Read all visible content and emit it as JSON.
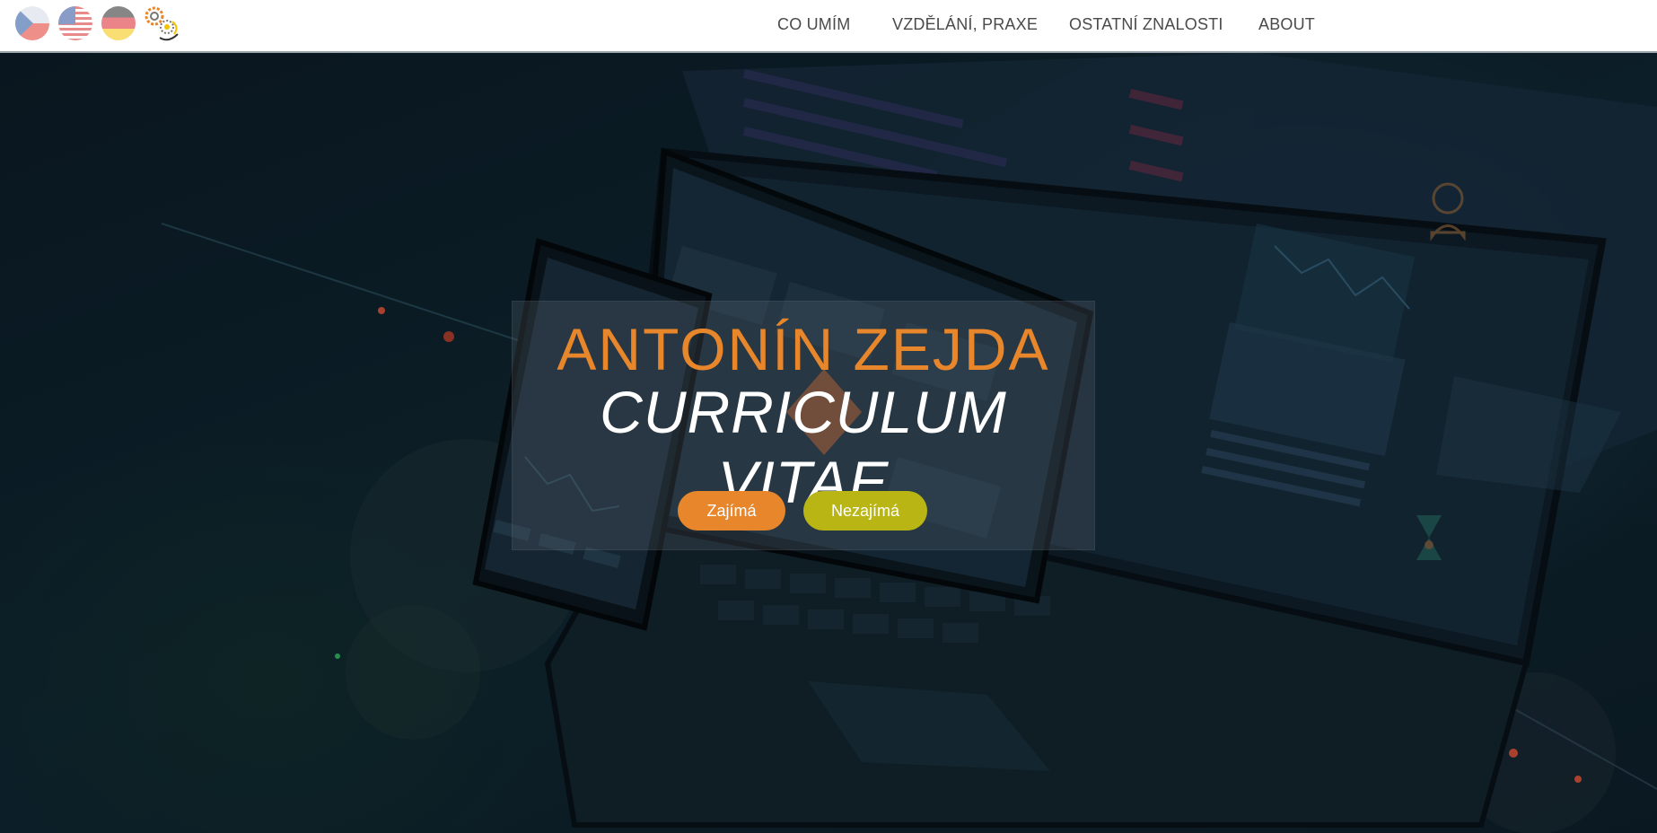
{
  "nav": {
    "languages": [
      {
        "name": "cz-flag-icon"
      },
      {
        "name": "us-flag-icon"
      },
      {
        "name": "de-flag-icon"
      }
    ],
    "logo_icon": "gear-logo-icon",
    "items": [
      "CO UMÍM",
      "VZDĚLÁNÍ, PRAXE",
      "OSTATNÍ ZNALOSTI",
      "ABOUT"
    ]
  },
  "hero": {
    "name": "ANTONÍN ZEJDA",
    "subtitle": "CURRICULUM VITAE",
    "buttons": {
      "interested": "Zajímá",
      "not_interested": "Nezajímá"
    }
  },
  "colors": {
    "accent_orange": "#e7862a",
    "accent_olive": "#b9b514",
    "nav_text": "#4a4a4a",
    "hero_bg": "#0c1c26"
  }
}
